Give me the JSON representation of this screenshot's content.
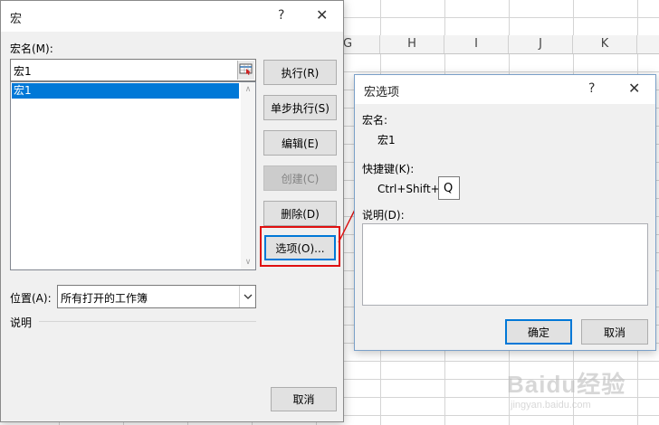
{
  "sheet": {
    "columns": [
      "G",
      "H",
      "I",
      "J",
      "K"
    ]
  },
  "macro_dialog": {
    "title": "宏",
    "help_glyph": "?",
    "close_glyph": "✕",
    "macro_name_label": "宏名(M):",
    "macro_name_value": "宏1",
    "macros": [
      "宏1"
    ],
    "buttons": {
      "run": "执行(R)",
      "step": "单步执行(S)",
      "edit": "编辑(E)",
      "create": "创建(C)",
      "delete": "删除(D)",
      "options": "选项(O)...",
      "cancel": "取消"
    },
    "location_label": "位置(A):",
    "location_value": "所有打开的工作簿",
    "description_label": "说明"
  },
  "options_dialog": {
    "title": "宏选项",
    "help_glyph": "?",
    "close_glyph": "✕",
    "macro_name_label": "宏名:",
    "macro_name_value": "宏1",
    "shortcut_label": "快捷键(K):",
    "shortcut_prefix": "Ctrl+Shift+",
    "shortcut_key": "Q",
    "description_label": "说明(D):",
    "description_value": "",
    "ok_button": "确定",
    "cancel_button": "取消"
  },
  "watermark": {
    "text": "Baidu经验",
    "subtext": "jingyan.baidu.com"
  },
  "colors": {
    "accent": "#0078d7",
    "highlight": "#e01010"
  }
}
